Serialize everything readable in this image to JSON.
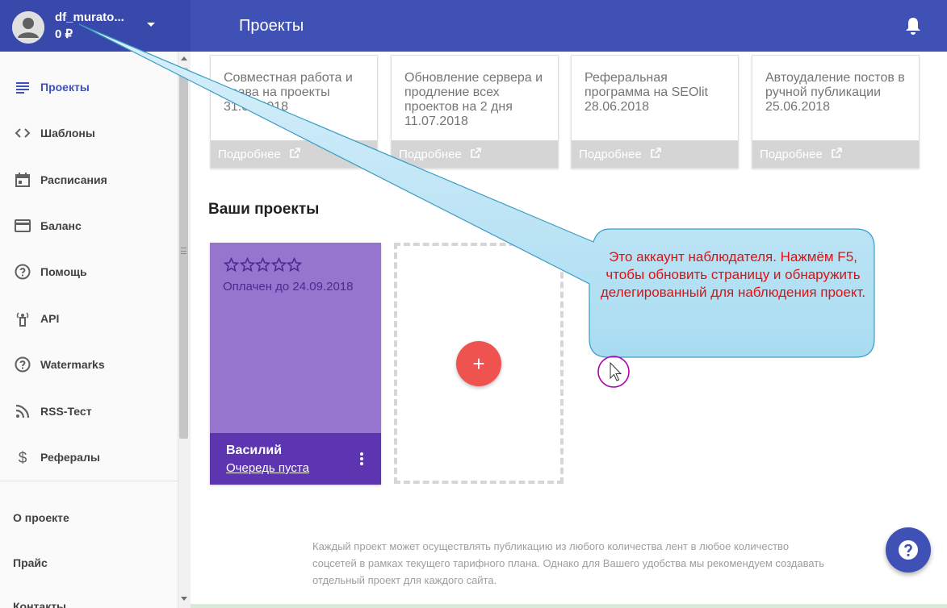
{
  "header": {
    "account_name": "df_murato...",
    "balance": "0 ₽",
    "title": "Проекты"
  },
  "sidebar": {
    "items": [
      {
        "label": "Проекты",
        "icon": "list-icon",
        "active": true
      },
      {
        "label": "Шаблоны",
        "icon": "code-icon"
      },
      {
        "label": "Расписания",
        "icon": "calendar-icon"
      },
      {
        "label": "Баланс",
        "icon": "credit-card-icon"
      },
      {
        "label": "Помощь",
        "icon": "help-circle-icon"
      },
      {
        "label": "API",
        "icon": "antenna-icon"
      },
      {
        "label": "Watermarks",
        "icon": "help-circle-icon"
      },
      {
        "label": "RSS-Тест",
        "icon": "rss-icon"
      },
      {
        "label": "Рефералы",
        "icon": "dollar-icon"
      }
    ],
    "links": [
      "О проекте",
      "Прайс",
      "Контакты"
    ]
  },
  "news": [
    {
      "text": "Совместная работа и права на проекты",
      "date": "31.07.2018",
      "more": "Подробнее"
    },
    {
      "text": "Обновление сервера и продление всех проектов на 2 дня",
      "date": "11.07.2018",
      "more": "Подробнее"
    },
    {
      "text": "Реферальная программа на SEOlit",
      "date": "28.06.2018",
      "more": "Подробнее"
    },
    {
      "text": "Автоудаление постов в ручной публикации",
      "date": "25.06.2018",
      "more": "Подробнее"
    }
  ],
  "projects_section": {
    "title": "Ваши проекты"
  },
  "project": {
    "rating": 0,
    "rating_max": 5,
    "paid_until": "Оплачен до 24.09.2018",
    "name": "Василий",
    "queue": "Очередь пуста"
  },
  "add_button": "+",
  "footer_note": "Каждый проект может осуществлять публикацию из любого количества лент в любое количество соцсетей в рамках текущего тарифного плана. Однако для Вашего удобства мы рекомендуем создавать отдельный проект для каждого сайта.",
  "callout": "Это аккаунт наблюдателя. Нажмём F5, чтобы обновить страницу и обнаружить делегированный для наблюдения проект.",
  "colors": {
    "header": "#3f51b5",
    "account_panel": "#3949ab",
    "project_card": "#9575cd",
    "project_footer": "#5e35b1",
    "add_fab": "#ef5350",
    "callout_fill": "#bfe4f4",
    "callout_text": "#e01010"
  }
}
